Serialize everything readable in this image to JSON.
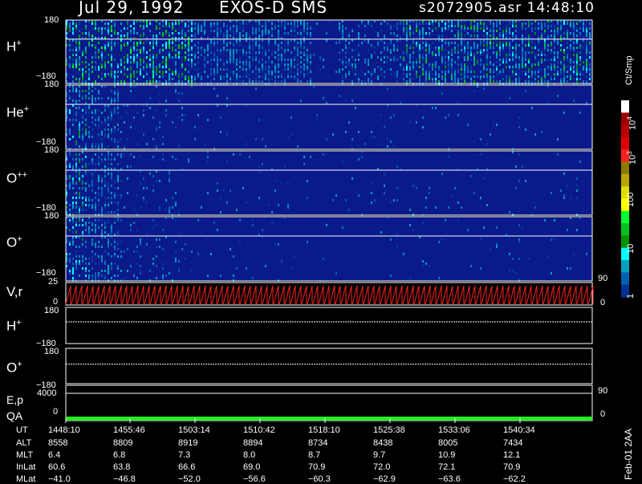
{
  "header": {
    "date": "Jul 29, 1992",
    "instrument": "EXOS-D SMS",
    "file_time": "s2072905.asr  14:48:10"
  },
  "footer_stamp": "Feb-01 2AA",
  "colorbar": {
    "unit": "Ct/Smp",
    "tick_labels": [
      "10",
      "10",
      "100",
      "10",
      "1"
    ],
    "tick_superscripts": [
      "4",
      "3",
      "",
      "",
      ""
    ],
    "colors": [
      "#ffffff",
      "#9a0000",
      "#b80000",
      "#e00000",
      "#ff2020",
      "#8a7a00",
      "#b8a400",
      "#e0e000",
      "#ffff00",
      "#00ff30",
      "#00c020",
      "#009000",
      "#00ffff",
      "#00a0c0",
      "#0060b0",
      "#003090"
    ]
  },
  "panels": [
    {
      "label": "H",
      "sup": "+",
      "ymax": "180",
      "ymin": "−180"
    },
    {
      "label": "He",
      "sup": "+",
      "ymax": "180",
      "ymin": "−180"
    },
    {
      "label": "O",
      "sup": "++",
      "ymax": "180",
      "ymin": "−180"
    },
    {
      "label": "O",
      "sup": "+",
      "ymax": "180",
      "ymin": "−180"
    },
    {
      "label": "V,r",
      "sup": "",
      "ymax": "25",
      "ymin": "0",
      "right_max": "90",
      "right_min": "0"
    },
    {
      "label": "H",
      "sup": "+",
      "ymax": "180",
      "ymin": "−180"
    },
    {
      "label": "O",
      "sup": "+",
      "ymax": "180",
      "ymin": "−180"
    },
    {
      "label": "E,p",
      "sup": "",
      "label2": "QA",
      "ymax": "4000",
      "ymin": "0",
      "right_max": "90",
      "right_min": "0"
    }
  ],
  "table": {
    "row_labels": [
      "UT",
      "ALT",
      "MLT",
      "InLat",
      "MLat"
    ],
    "columns": [
      [
        "1448:10",
        "8558",
        "6.4",
        "60.6",
        "−41.0"
      ],
      [
        "1455:46",
        "8809",
        "6.8",
        "63.8",
        "−46.8"
      ],
      [
        "1503:14",
        "8919",
        "7.3",
        "66.6",
        "−52.0"
      ],
      [
        "1510:42",
        "8894",
        "8.0",
        "69.0",
        "−56.6"
      ],
      [
        "1518:10",
        "8734",
        "8.7",
        "70.9",
        "−60.3"
      ],
      [
        "1525:38",
        "8438",
        "9.7",
        "72.0",
        "−62.9"
      ],
      [
        "1533:06",
        "8005",
        "10.9",
        "72.1",
        "−63.6"
      ],
      [
        "1540:34",
        "7434",
        "12.1",
        "70.9",
        "−62.2"
      ]
    ]
  },
  "chart_data": {
    "type": "heatmap",
    "description_units": "Ct/Smp",
    "x_ticks_UT": [
      "1448:10",
      "1455:46",
      "1503:14",
      "1510:42",
      "1518:10",
      "1525:38",
      "1533:06",
      "1540:34"
    ],
    "panels": [
      "H+",
      "He+",
      "O++",
      "O+",
      "V,r",
      "H+",
      "O+",
      "E,p/QA"
    ],
    "pitch_angle_range": [
      -180,
      180
    ],
    "Vr_range": [
      0,
      25
    ],
    "Ep_range": [
      0,
      4000
    ],
    "colorbar_log_range": [
      1,
      10000
    ]
  }
}
